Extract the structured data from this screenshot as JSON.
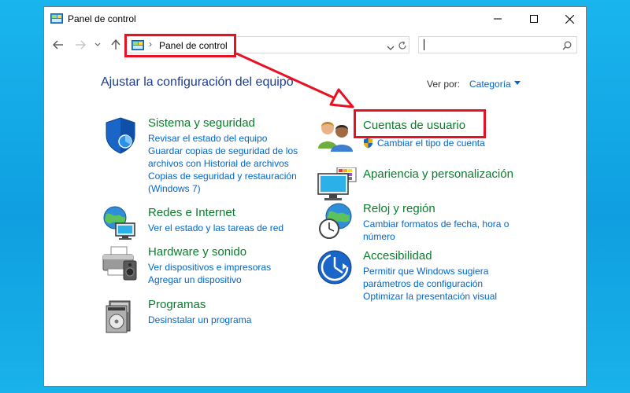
{
  "window": {
    "title": "Panel de control"
  },
  "address": {
    "path": "Panel de control"
  },
  "search": {
    "placeholder": ""
  },
  "page": {
    "heading": "Ajustar la configuración del equipo",
    "view_label": "Ver por:",
    "view_value": "Categoría"
  },
  "categories": [
    {
      "title": "Sistema y seguridad",
      "links": [
        "Revisar el estado del equipo",
        "Guardar copias de seguridad de los archivos con Historial de archivos",
        "Copias de seguridad y restauración (Windows 7)"
      ],
      "icon": "shield-icon"
    },
    {
      "title": "Redes e Internet",
      "links": [
        "Ver el estado y las tareas de red"
      ],
      "icon": "network-icon"
    },
    {
      "title": "Hardware y sonido",
      "links": [
        "Ver dispositivos e impresoras",
        "Agregar un dispositivo"
      ],
      "icon": "printer-icon"
    },
    {
      "title": "Programas",
      "links": [
        "Desinstalar un programa"
      ],
      "icon": "programs-icon"
    },
    {
      "title": "Cuentas de usuario",
      "links": [
        "Cambiar el tipo de cuenta"
      ],
      "icon": "users-icon"
    },
    {
      "title": "Apariencia y personalización",
      "links": [],
      "icon": "monitor-icon"
    },
    {
      "title": "Reloj y región",
      "links": [
        "Cambiar formatos de fecha, hora o número"
      ],
      "icon": "clock-globe-icon"
    },
    {
      "title": "Accesibilidad",
      "links": [
        "Permitir que Windows sugiera parámetros de configuración",
        "Optimizar la presentación visual"
      ],
      "icon": "accessibility-icon"
    }
  ],
  "colors": {
    "highlight": "#e81123",
    "category_title": "#0a7d2c",
    "link": "#0066cc",
    "heading": "#1e3d8f",
    "desktop": "#19b5ee"
  }
}
